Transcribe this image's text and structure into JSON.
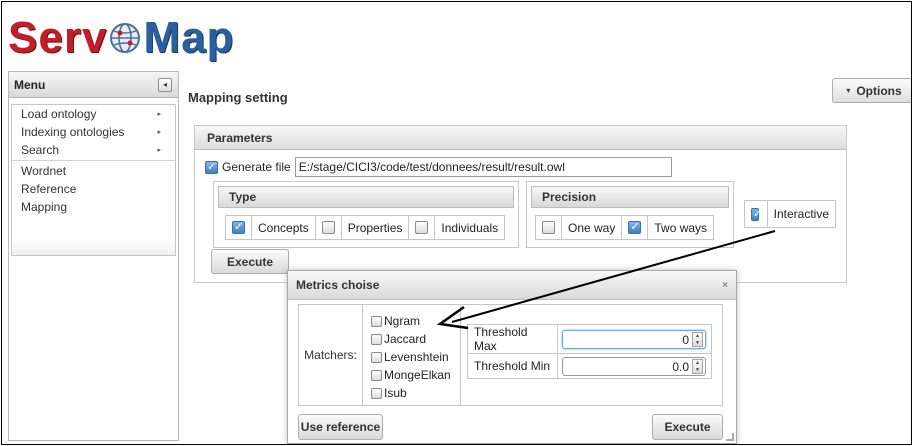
{
  "logo": {
    "part1": "Serv",
    "part2": "Map"
  },
  "menu": {
    "title": "Menu",
    "collapse_icon": "◂",
    "items": [
      {
        "label": "Load ontology",
        "has_submenu": true
      },
      {
        "label": "Indexing ontologies",
        "has_submenu": true
      },
      {
        "label": "Search",
        "has_submenu": true
      },
      {
        "label": "Wordnet",
        "has_submenu": false
      },
      {
        "label": "Reference",
        "has_submenu": false
      },
      {
        "label": "Mapping",
        "has_submenu": false
      }
    ],
    "submenu_arrow": "▸"
  },
  "main": {
    "title": "Mapping setting",
    "options_label": "Options",
    "options_caret": "▾"
  },
  "parameters": {
    "title": "Parameters",
    "generate_file_label": "Generate file",
    "generate_file_checked": true,
    "file_path": "E:/stage/CICI3/code/test/donnees/result/result.owl",
    "type": {
      "title": "Type",
      "concepts": {
        "label": "Concepts",
        "checked": true
      },
      "properties": {
        "label": "Properties",
        "checked": false
      },
      "individuals": {
        "label": "Individuals",
        "checked": false
      }
    },
    "precision": {
      "title": "Precision",
      "one_way": {
        "label": "One way",
        "checked": false
      },
      "two_ways": {
        "label": "Two ways",
        "checked": true
      }
    },
    "interactive": {
      "label": "Interactive",
      "checked": true
    },
    "execute_label": "Execute"
  },
  "dialog": {
    "title": "Metrics choise",
    "close_icon": "×",
    "matchers_label": "Matchers:",
    "matchers": [
      "Ngram",
      "Jaccard",
      "Levenshtein",
      "MongeElkan",
      "Isub"
    ],
    "threshold_max": {
      "label": "Threshold Max",
      "value": "0"
    },
    "threshold_min": {
      "label": "Threshold Min",
      "value": "0.0"
    },
    "use_reference_label": "Use reference",
    "execute_label": "Execute"
  },
  "colors": {
    "logo_red": "#c21e2a",
    "logo_blue": "#2d5f9e",
    "checkbox_blue": "#3c7fc8"
  }
}
